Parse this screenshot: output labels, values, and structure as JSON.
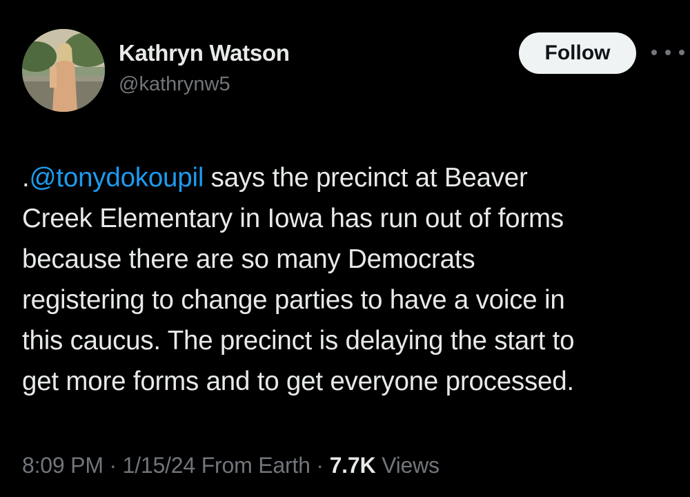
{
  "user": {
    "display_name": "Kathryn Watson",
    "handle": "@kathrynw5"
  },
  "actions": {
    "follow_label": "Follow",
    "more_icon": "more-horizontal-icon"
  },
  "tweet": {
    "prefix": ".",
    "mention": "@tonydokoupil",
    "line1_rest": " says the precinct at Beaver",
    "line2": "Creek Elementary in Iowa has run out of forms",
    "line3": "because there are so many Democrats",
    "line4": "registering to change parties to have a voice in",
    "line5": "this caucus. The precinct is delaying the start to",
    "line6": "get more forms and to get everyone processed."
  },
  "meta": {
    "time": "8:09 PM",
    "sep1": " · ",
    "date": "1/15/24",
    "source": " From Earth",
    "sep2": " · ",
    "views_count": "7.7K",
    "views_label": " Views"
  },
  "colors": {
    "background": "#000000",
    "text": "#e7e9ea",
    "secondary": "#71767b",
    "link": "#1d9bf0",
    "follow_bg": "#eff3f4"
  }
}
